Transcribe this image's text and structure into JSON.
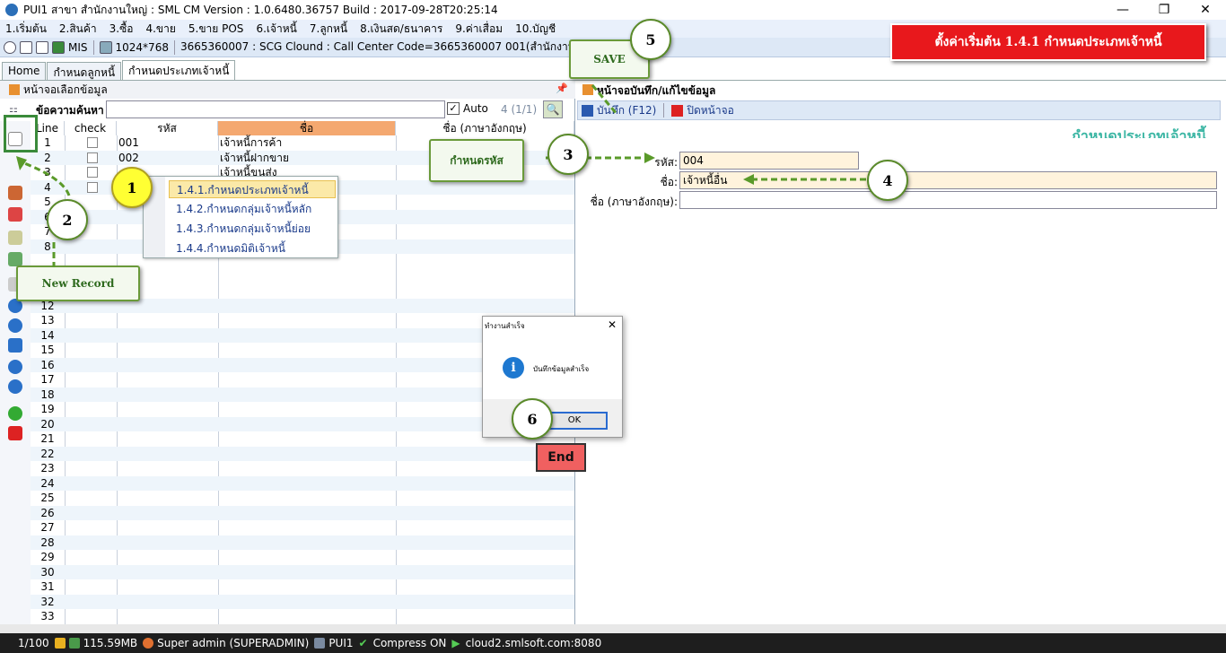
{
  "window": {
    "title": "PUI1 สาขา สำนักงานใหญ่ : SML CM Version : 1.0.6480.36757  Build : 2017-09-28T20:25:14",
    "minimize": "—",
    "restore": "❐",
    "close": "✕"
  },
  "menu": [
    "1.เริ่มต้น",
    "2.สินค้า",
    "3.ซื้อ",
    "4.ขาย",
    "5.ขาย POS",
    "6.เจ้าหนี้",
    "7.ลูกหนี้",
    "8.เงินสด/ธนาคาร",
    "9.ค่าเสื่อม",
    "10.บัญชี"
  ],
  "toolbar": {
    "mis": "MIS",
    "resolution": "1024*768",
    "info": "3665360007 : SCG Clound : Call Center Code=3665360007 001(สำนักงานใหญ่)"
  },
  "banner": "ตั้งค่าเริ่มต้น 1.4.1 กำหนดประเภทเจ้าหนี้",
  "tabs": [
    "Home",
    "กำหนดลูกหนี้",
    "กำหนดประเภทเจ้าหนี้"
  ],
  "left_panel": {
    "title": "หน้าจอเลือกข้อมูล",
    "pin": "📌",
    "search_label": "ข้อความค้นหา",
    "search_value": "",
    "auto_label": "Auto",
    "auto_checked": "✓",
    "count": "4 (1/1)",
    "zoom": "🔍"
  },
  "grid": {
    "headers": {
      "line": "Line",
      "check": "check",
      "code": "รหัส",
      "name": "ชื่อ",
      "name_en": "ชื่อ (ภาษาอังกฤษ)"
    },
    "rows": [
      {
        "line": "1",
        "code": "001",
        "name": "เจ้าหนี้การค้า"
      },
      {
        "line": "2",
        "code": "002",
        "name": "เจ้าหนี้ฝากขาย"
      },
      {
        "line": "3",
        "code": "",
        "name": "เจ้าหนี้ขนส่ง"
      },
      {
        "line": "4",
        "code": "",
        "name": ""
      },
      {
        "line": "5",
        "code": "",
        "name": ""
      },
      {
        "line": "6",
        "code": "",
        "name": ""
      },
      {
        "line": "7",
        "code": "",
        "name": ""
      },
      {
        "line": "8",
        "code": "",
        "name": ""
      }
    ],
    "more_lines": [
      "12",
      "13",
      "14",
      "15",
      "16",
      "17",
      "18",
      "19",
      "20",
      "21",
      "22",
      "23",
      "24",
      "25",
      "26",
      "27",
      "28",
      "29",
      "30",
      "31",
      "32",
      "33"
    ]
  },
  "context_menu": [
    "1.4.1.กำหนดประเภทเจ้าหนี้",
    "1.4.2.กำหนดกลุ่มเจ้าหนี้หลัก",
    "1.4.3.กำหนดกลุ่มเจ้าหนี้ย่อย",
    "1.4.4.กำหนดมิติเจ้าหนี้"
  ],
  "right_panel": {
    "title": "หน้าจอบันทึก/แก้ไขข้อมูล",
    "save_label": "บันทึก (F12)",
    "close_label": "ปิดหน้าจอ",
    "watermark": "กำหนดประเภทเจ้าหนี้",
    "code_label": "รหัส:",
    "code_value": "004",
    "name_label": "ชื่อ:",
    "name_value": "เจ้าหนี้อื่น",
    "name_en_label": "ชื่อ (ภาษาอังกฤษ):",
    "name_en_value": ""
  },
  "callouts": {
    "save": "SAVE",
    "code": "กำหนดรหัส",
    "new_record": "New Record",
    "end": "End"
  },
  "steps": [
    "1",
    "2",
    "3",
    "4",
    "5",
    "6"
  ],
  "dialog": {
    "title": "ทำงานสำเร็จ",
    "close": "✕",
    "icon": "i",
    "message": "บันทึกข้อมูลสำเร็จ",
    "ok": "OK"
  },
  "status": {
    "page": "1/100",
    "memory": "115.59MB",
    "user": "Super admin (SUPERADMIN)",
    "branch": "PUI1",
    "compress": "Compress ON",
    "server": "cloud2.smlsoft.com:8080"
  }
}
